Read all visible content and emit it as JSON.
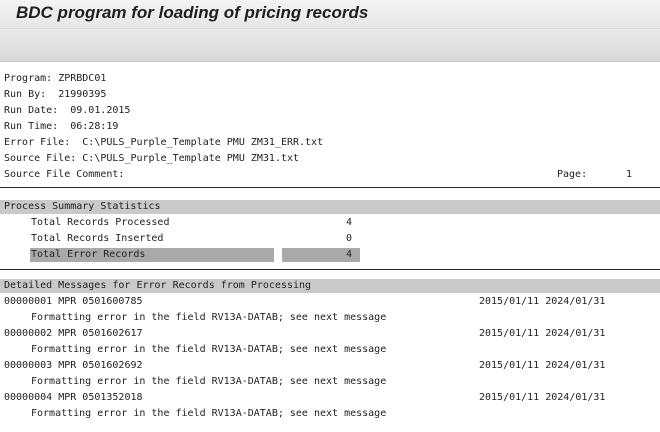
{
  "window": {
    "title": "BDC program for loading of pricing records"
  },
  "header": {
    "program_label": "Program:",
    "program": "ZPRBDC01",
    "run_by_label": "Run By:",
    "run_by": "21990395",
    "run_date_label": "Run Date:",
    "run_date": "09.01.2015",
    "run_time_label": "Run Time:",
    "run_time": "06:28:19",
    "error_file_label": "Error File:",
    "error_file": "C:\\PULS_Purple_Template PMU ZM31_ERR.txt",
    "source_file_label": "Source File:",
    "source_file": "C:\\PULS_Purple_Template PMU ZM31.txt",
    "source_comment_label": "Source File Comment:",
    "page_label": "Page:",
    "page": "1"
  },
  "summary": {
    "heading": "Process Summary Statistics",
    "rows": [
      {
        "label": "Total Records Processed",
        "value": "4"
      },
      {
        "label": "Total Records Inserted",
        "value": "0"
      },
      {
        "label": "Total Error Records",
        "value": "4"
      }
    ]
  },
  "details": {
    "heading": "Detailed Messages for Error Records from Processing",
    "records": [
      {
        "id": "00000001",
        "type": "MPR",
        "material": "0501600785",
        "valid_from": "2015/01/11",
        "valid_to": "2024/01/31",
        "message": "Formatting error in the field RV13A-DATAB; see next message"
      },
      {
        "id": "00000002",
        "type": "MPR",
        "material": "0501602617",
        "valid_from": "2015/01/11",
        "valid_to": "2024/01/31",
        "message": "Formatting error in the field RV13A-DATAB; see next message"
      },
      {
        "id": "00000003",
        "type": "MPR",
        "material": "0501602692",
        "valid_from": "2015/01/11",
        "valid_to": "2024/01/31",
        "message": "Formatting error in the field RV13A-DATAB; see next message"
      },
      {
        "id": "00000004",
        "type": "MPR",
        "material": "0501352018",
        "valid_from": "2015/01/11",
        "valid_to": "2024/01/31",
        "message": "Formatting error in the field RV13A-DATAB; see next message"
      }
    ]
  },
  "colors": {
    "section_bar": "#c9c9c9",
    "error_highlight": "#a9a9a9",
    "rule": "#2a2a2a"
  }
}
